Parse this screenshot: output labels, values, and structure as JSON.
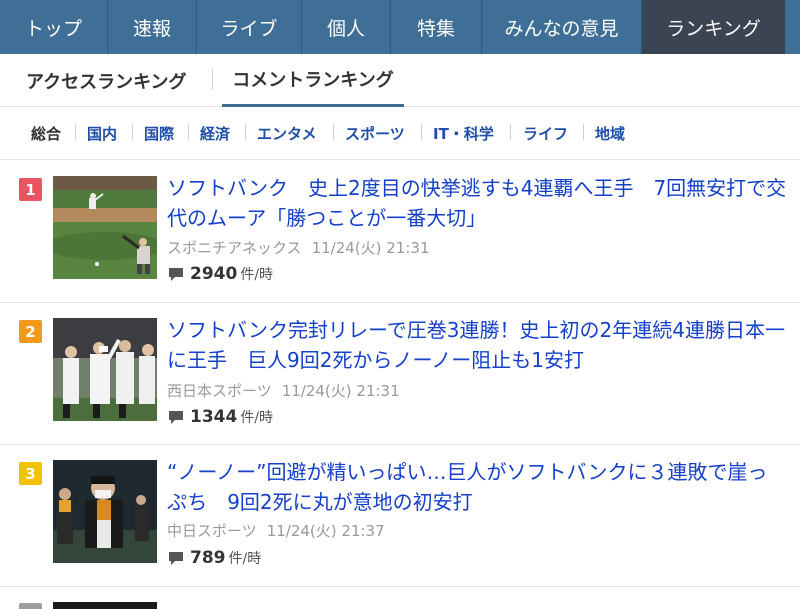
{
  "nav": {
    "items": [
      {
        "label": "トップ",
        "active": false
      },
      {
        "label": "速報",
        "active": false
      },
      {
        "label": "ライブ",
        "active": false
      },
      {
        "label": "個人",
        "active": false
      },
      {
        "label": "特集",
        "active": false
      },
      {
        "label": "みんなの意見",
        "active": false
      },
      {
        "label": "ランキング",
        "active": true
      }
    ]
  },
  "ranking_tabs": [
    {
      "label": "アクセスランキング",
      "active": false
    },
    {
      "label": "コメントランキング",
      "active": true
    }
  ],
  "categories": [
    {
      "label": "総合",
      "current": true
    },
    {
      "label": "国内",
      "current": false
    },
    {
      "label": "国際",
      "current": false
    },
    {
      "label": "経済",
      "current": false
    },
    {
      "label": "エンタメ",
      "current": false
    },
    {
      "label": "スポーツ",
      "current": false
    },
    {
      "label": "IT・科学",
      "current": false
    },
    {
      "label": "ライフ",
      "current": false
    },
    {
      "label": "地域",
      "current": false
    }
  ],
  "ranking": [
    {
      "rank": "1",
      "title": "ソフトバンク　史上2度目の快挙逃すも4連覇へ王手　7回無安打で交代のムーア「勝つことが一番大切」",
      "source": "スポニチアネックス",
      "date": "11/24(火) 21:31",
      "comments": "2940",
      "unit": "件/時"
    },
    {
      "rank": "2",
      "title": "ソフトバンク完封リレーで圧巻3連勝！史上初の2年連続4連勝日本一に王手　巨人9回2死からノーノー阻止も1安打",
      "source": "西日本スポーツ",
      "date": "11/24(火) 21:31",
      "comments": "1344",
      "unit": "件/時"
    },
    {
      "rank": "3",
      "title": "“ノーノー”回避が精いっぱい…巨人がソフトバンクに３連敗で崖っぷち　9回2死に丸が意地の初安打",
      "source": "中日スポーツ",
      "date": "11/24(火) 21:37",
      "comments": "789",
      "unit": "件/時"
    }
  ],
  "colors": {
    "nav_bg": "#3f6f97",
    "nav_active": "#3b4452",
    "link": "#1540c9",
    "rank1": "#e8545f",
    "rank2": "#f19a1a",
    "rank3": "#f2c200",
    "rank4": "#9e9e9e"
  }
}
